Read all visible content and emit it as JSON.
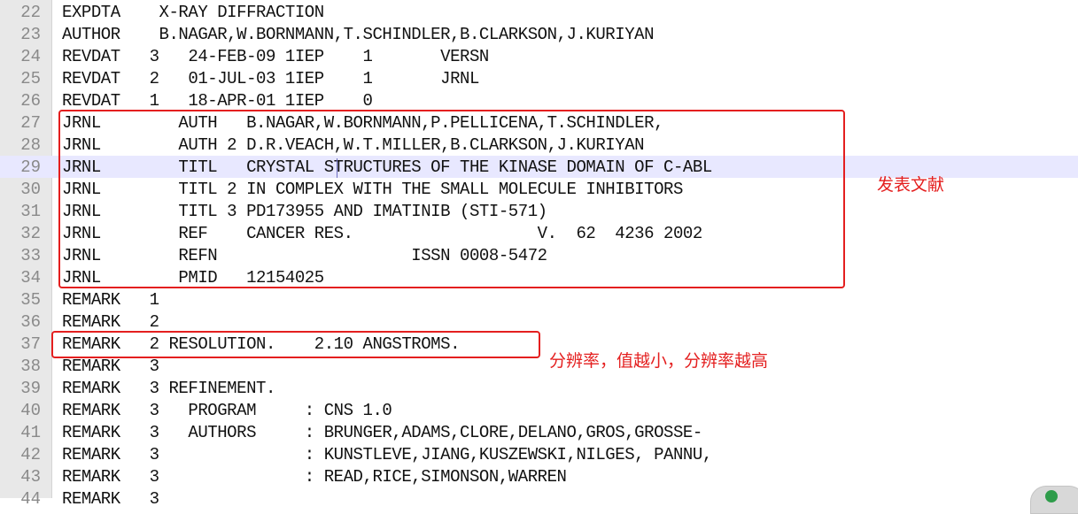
{
  "editor": {
    "lines": [
      {
        "num": "22",
        "text": "EXPDTA    X-RAY DIFFRACTION"
      },
      {
        "num": "23",
        "text": "AUTHOR    B.NAGAR,W.BORNMANN,T.SCHINDLER,B.CLARKSON,J.KURIYAN"
      },
      {
        "num": "24",
        "text": "REVDAT   3   24-FEB-09 1IEP    1       VERSN"
      },
      {
        "num": "25",
        "text": "REVDAT   2   01-JUL-03 1IEP    1       JRNL"
      },
      {
        "num": "26",
        "text": "REVDAT   1   18-APR-01 1IEP    0"
      },
      {
        "num": "27",
        "text": "JRNL        AUTH   B.NAGAR,W.BORNMANN,P.PELLICENA,T.SCHINDLER,"
      },
      {
        "num": "28",
        "text": "JRNL        AUTH 2 D.R.VEACH,W.T.MILLER,B.CLARKSON,J.KURIYAN"
      },
      {
        "num": "29",
        "text": "JRNL        TITL   CRYSTAL STRUCTURES OF THE KINASE DOMAIN OF C-ABL"
      },
      {
        "num": "30",
        "text": "JRNL        TITL 2 IN COMPLEX WITH THE SMALL MOLECULE INHIBITORS"
      },
      {
        "num": "31",
        "text": "JRNL        TITL 3 PD173955 AND IMATINIB (STI-571)"
      },
      {
        "num": "32",
        "text": "JRNL        REF    CANCER RES.                   V.  62  4236 2002"
      },
      {
        "num": "33",
        "text": "JRNL        REFN                    ISSN 0008-5472"
      },
      {
        "num": "34",
        "text": "JRNL        PMID   12154025"
      },
      {
        "num": "35",
        "text": "REMARK   1"
      },
      {
        "num": "36",
        "text": "REMARK   2"
      },
      {
        "num": "37",
        "text": "REMARK   2 RESOLUTION.    2.10 ANGSTROMS."
      },
      {
        "num": "38",
        "text": "REMARK   3"
      },
      {
        "num": "39",
        "text": "REMARK   3 REFINEMENT."
      },
      {
        "num": "40",
        "text": "REMARK   3   PROGRAM     : CNS 1.0"
      },
      {
        "num": "41",
        "text": "REMARK   3   AUTHORS     : BRUNGER,ADAMS,CLORE,DELANO,GROS,GROSSE-"
      },
      {
        "num": "42",
        "text": "REMARK   3               : KUNSTLEVE,JIANG,KUSZEWSKI,NILGES, PANNU,"
      },
      {
        "num": "43",
        "text": "REMARK   3               : READ,RICE,SIMONSON,WARREN"
      },
      {
        "num": "44",
        "text": "REMARK   3"
      }
    ]
  },
  "annotations": {
    "publication_label": "发表文献",
    "resolution_label": "分辨率，值越小，分辨率越高",
    "color": "#e41f1f"
  },
  "colors": {
    "current_line": "#e8e8ff",
    "gutter": "#e8e8e8",
    "line_number": "#8a8a8a"
  }
}
